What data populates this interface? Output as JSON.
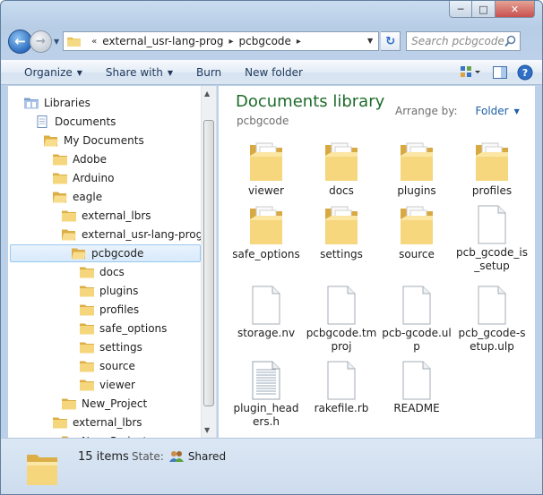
{
  "window": {
    "minimize_glyph": "─",
    "maximize_glyph": "□",
    "close_glyph": "✕"
  },
  "nav": {
    "back_glyph": "←",
    "forward_glyph": "→",
    "history_glyph": "▼",
    "refresh_glyph": "↻",
    "overflow_glyph": "«",
    "crumb_sep_glyph": "▸",
    "dropdown_glyph": "▼"
  },
  "address": {
    "crumbs": [
      "external_usr-lang-prog",
      "pcbgcode"
    ]
  },
  "search": {
    "placeholder": "Search pcbgcode"
  },
  "toolbar": {
    "organize": "Organize",
    "share_with": "Share with",
    "burn": "Burn",
    "new_folder": "New folder",
    "caret": "▼"
  },
  "tree": {
    "items": [
      {
        "label": "Libraries",
        "icon": "libraries-icon"
      },
      {
        "label": "Documents",
        "icon": "documents-library-icon"
      },
      {
        "label": "My Documents",
        "icon": "folder-open-icon"
      },
      {
        "label": "Adobe",
        "icon": "folder-icon"
      },
      {
        "label": "Arduino",
        "icon": "folder-icon"
      },
      {
        "label": "eagle",
        "icon": "folder-open-icon"
      },
      {
        "label": "external_lbrs",
        "icon": "folder-icon"
      },
      {
        "label": "external_usr-lang-prog",
        "icon": "folder-open-icon"
      },
      {
        "label": "pcbgcode",
        "icon": "folder-open-icon"
      },
      {
        "label": "docs",
        "icon": "folder-icon"
      },
      {
        "label": "plugins",
        "icon": "folder-icon"
      },
      {
        "label": "profiles",
        "icon": "folder-icon"
      },
      {
        "label": "safe_options",
        "icon": "folder-icon"
      },
      {
        "label": "settings",
        "icon": "folder-icon"
      },
      {
        "label": "source",
        "icon": "folder-icon"
      },
      {
        "label": "viewer",
        "icon": "folder-icon"
      },
      {
        "label": "New_Project",
        "icon": "folder-icon"
      },
      {
        "label": "external_lbrs",
        "icon": "folder-icon"
      },
      {
        "label": "New_Project",
        "icon": "folder-icon"
      }
    ],
    "selected_label": "pcbgcode"
  },
  "library": {
    "title": "Documents library",
    "subtitle": "pcbgcode",
    "arrange_label": "Arrange by:",
    "arrange_value": "Folder",
    "arrange_caret": "▼"
  },
  "files": [
    {
      "name": "viewer",
      "type": "folder-with-content-icon"
    },
    {
      "name": "docs",
      "type": "folder-with-content-icon"
    },
    {
      "name": "plugins",
      "type": "folder-with-content-icon"
    },
    {
      "name": "profiles",
      "type": "folder-with-content-icon"
    },
    {
      "name": "safe_options",
      "type": "folder-with-content-icon"
    },
    {
      "name": "settings",
      "type": "folder-with-content-icon"
    },
    {
      "name": "source",
      "type": "folder-with-content-icon"
    },
    {
      "name": "pcb_gcode_is_setup",
      "type": "file-icon"
    },
    {
      "name": "storage.nv",
      "type": "file-icon"
    },
    {
      "name": "pcbgcode.tmproj",
      "type": "file-icon"
    },
    {
      "name": "pcb-gcode.ulp",
      "type": "file-icon"
    },
    {
      "name": "pcb_gcode-setup.ulp",
      "type": "file-icon"
    },
    {
      "name": "plugin_headers.h",
      "type": "text-file-icon"
    },
    {
      "name": "rakefile.rb",
      "type": "file-icon"
    },
    {
      "name": "README",
      "type": "file-icon"
    }
  ],
  "status": {
    "count": "15 items",
    "state_label": "State:",
    "state_value": "Shared"
  },
  "colors": {
    "title_green": "#1e6b2a",
    "link_blue": "#1f5fa8",
    "folder_yellow": "#f3d27a",
    "selection": "#d8eafc"
  }
}
